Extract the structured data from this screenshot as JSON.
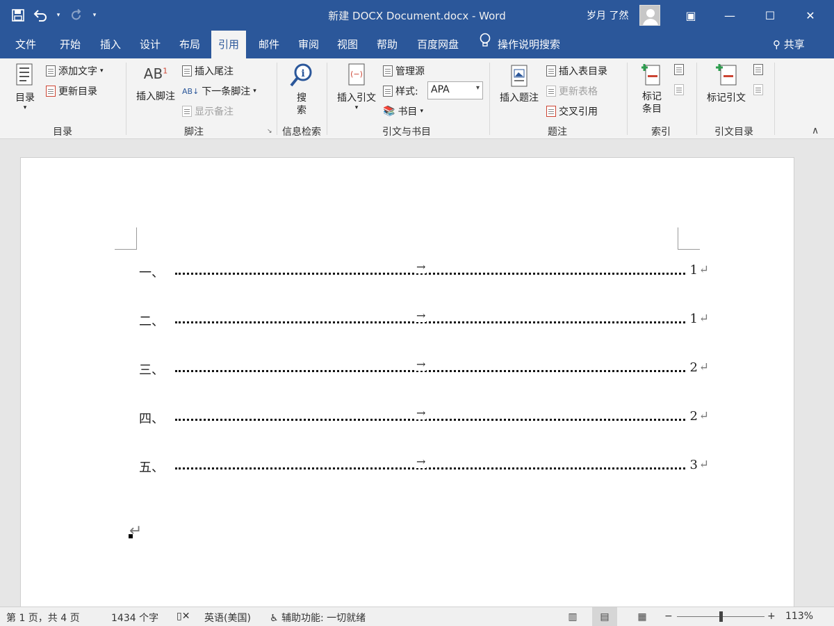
{
  "titlebar": {
    "title": "新建 DOCX Document.docx - Word",
    "user": "岁月 了然",
    "qat": {
      "save_icon": "save-icon",
      "undo_icon": "undo-icon",
      "redo_icon": "redo-icon"
    },
    "controls": {
      "ribbon_display": "▣",
      "minimize": "—",
      "maximize": "☐",
      "close": "✕"
    }
  },
  "tabs": [
    "文件",
    "开始",
    "插入",
    "设计",
    "布局",
    "引用",
    "邮件",
    "审阅",
    "视图",
    "帮助",
    "百度网盘"
  ],
  "active_tab": "引用",
  "tellme": "操作说明搜索",
  "share": "共享",
  "ribbon": {
    "toc": {
      "big": "目录",
      "add_text": "添加文字",
      "update_toc": "更新目录",
      "group": "目录"
    },
    "footnotes": {
      "insert_footnote": "插入脚注",
      "ab": "AB",
      "sup": "1",
      "insert_endnote": "插入尾注",
      "next_footnote": "下一条脚注",
      "show_notes": "显示备注",
      "group": "脚注"
    },
    "research": {
      "search_line1": "搜",
      "search_line2": "索",
      "group": "信息检索"
    },
    "citations": {
      "insert_citation": "插入引文",
      "manage_sources": "管理源",
      "style_label": "样式:",
      "style_value": "APA",
      "bibliography": "书目",
      "group": "引文与书目"
    },
    "captions": {
      "insert_caption": "插入题注",
      "insert_table_of_figures": "插入表目录",
      "update_table": "更新表格",
      "cross_reference": "交叉引用",
      "group": "题注"
    },
    "index": {
      "mark_entry_line1": "标记",
      "mark_entry_line2": "条目",
      "group": "索引"
    },
    "authorities": {
      "mark_citation": "标记引文",
      "group": "引文目录"
    }
  },
  "document": {
    "toc_entries": [
      {
        "num": "一、",
        "page": "1"
      },
      {
        "num": "二、",
        "page": "1"
      },
      {
        "num": "三、",
        "page": "2"
      },
      {
        "num": "四、",
        "page": "2"
      },
      {
        "num": "五、",
        "page": "3"
      }
    ],
    "tab_arrow": "→",
    "paragraph_mark": "↵"
  },
  "statusbar": {
    "page": "第 1 页，共 4 页",
    "words": "1434 个字",
    "language": "英语(美国)",
    "accessibility": "辅助功能: 一切就绪",
    "zoom": "113%",
    "minus": "−",
    "plus": "+"
  }
}
